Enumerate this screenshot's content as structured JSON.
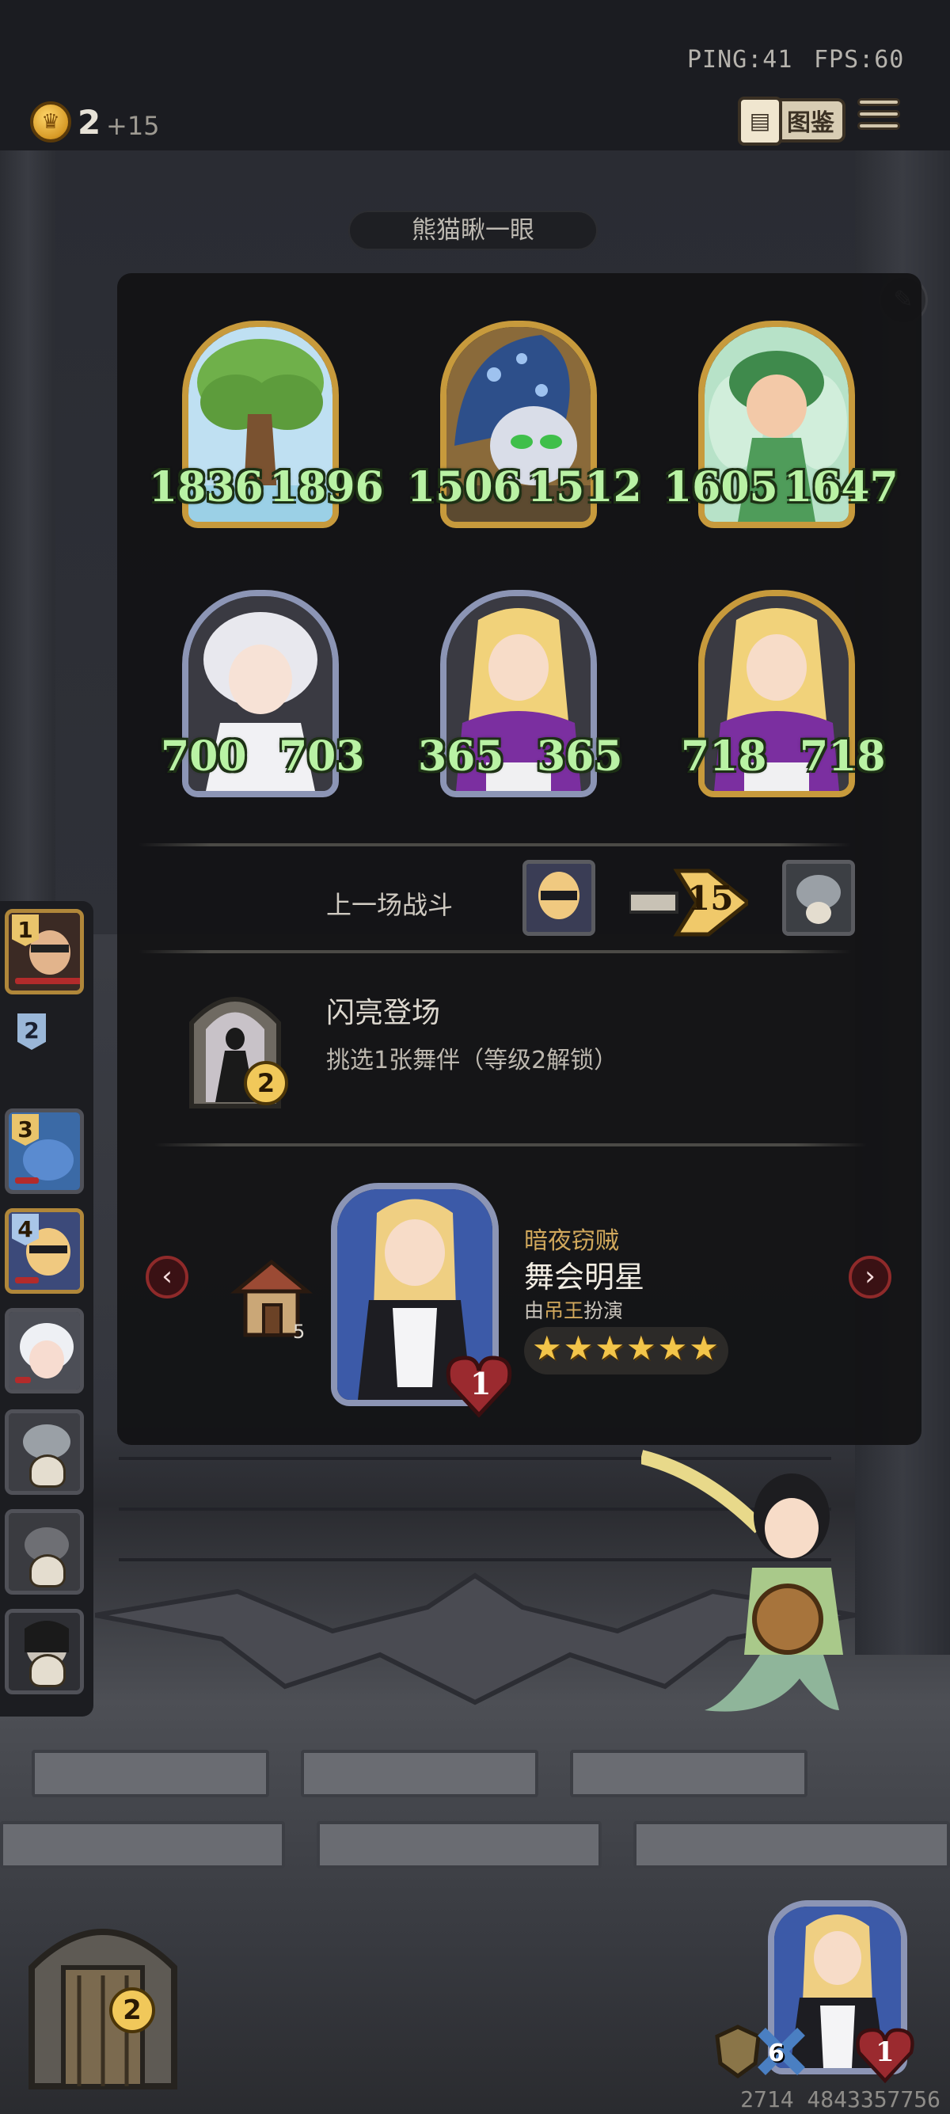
{
  "hud": {
    "ping": "PING:41",
    "fps": "FPS:60",
    "gold": "2",
    "gold_income": "+15",
    "codex_label": "图鉴",
    "icons": [
      "crown-coin-icon",
      "book-icon",
      "menu-icon"
    ]
  },
  "panel": {
    "title": "熊猫瞅一眼",
    "team": [
      {
        "name": "tree",
        "atk": "1836",
        "hp": "1896",
        "frame": "gold"
      },
      {
        "name": "blue-hooded-imp",
        "atk": "1506",
        "hp": "1512",
        "frame": "gold"
      },
      {
        "name": "leaf-fairy",
        "atk": "1605",
        "hp": "1647",
        "frame": "gold"
      },
      {
        "name": "white-haired-girl",
        "atk": "700",
        "hp": "703",
        "frame": "silver"
      },
      {
        "name": "purple-dress-dancer",
        "atk": "365",
        "hp": "365",
        "frame": "silver"
      },
      {
        "name": "purple-dress-dancer-gold",
        "atk": "718",
        "hp": "718",
        "frame": "gold"
      }
    ],
    "last_battle_label": "上一场战斗",
    "last_battle_damage": "15",
    "event_title": "闪亮登场",
    "event_desc": "挑选1张舞伴（等级2解锁）",
    "event_level": "2",
    "shop_card": {
      "subtitle": "暗夜窃贼",
      "name": "舞会明星",
      "actor_prefix": "由",
      "actor_name": "吊王",
      "actor_suffix": "扮演",
      "level": "1",
      "stars": 6
    },
    "shop_house_count": "5"
  },
  "sidebar": {
    "slots": [
      "1",
      "2",
      "3",
      "4"
    ]
  },
  "bottom": {
    "chest_count": "2",
    "player_badge_count": "6",
    "player_level": "1",
    "footer_numbers": "2714 4843357756"
  },
  "colors": {
    "stat_green": "#b9f2a4",
    "gold_frame": "#c79a3c",
    "silver_frame": "#8c95b5",
    "star": "#f3c54a"
  }
}
